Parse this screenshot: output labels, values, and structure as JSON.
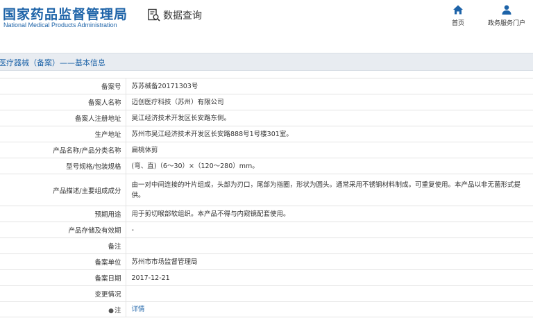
{
  "header": {
    "logo_cn": "国家药品监督管理局",
    "logo_en": "National Medical Products Administration",
    "query_label": "数据查询",
    "nav": [
      {
        "label": "首页",
        "icon": "home-icon"
      },
      {
        "label": "政务服务门户",
        "icon": "user-icon"
      }
    ]
  },
  "section": {
    "title": "医疗器械（备案）——基本信息"
  },
  "table": {
    "rows": [
      {
        "label": "备案号",
        "value": "苏苏械备20171303号"
      },
      {
        "label": "备案人名称",
        "value": "迈创医疗科技（苏州）有限公司"
      },
      {
        "label": "备案人注册地址",
        "value": "吴江经济技术开发区长安路东侧。"
      },
      {
        "label": "生产地址",
        "value": "苏州市吴江经济技术开发区长安路888号1号楼301室。"
      },
      {
        "label": "产品名称/产品分类名称",
        "value": "扁桃体剪"
      },
      {
        "label": "型号规格/包装规格",
        "value": "(弯、直)（6～30）×（120～280）mm。"
      },
      {
        "label": "产品描述/主要组成成分",
        "value": "由一对中间连接的叶片组成，头部为刃口，尾部为指圈，形状为圆头。通常采用不锈钢材料制成。可重复使用。本产品以非无菌形式提供。"
      },
      {
        "label": "预期用途",
        "value": "用于剪切喉部软组织。本产品不得与内窥镜配套使用。"
      },
      {
        "label": "产品存储及有效期",
        "value": "-"
      },
      {
        "label": "备注",
        "value": ""
      },
      {
        "label": "备案单位",
        "value": "苏州市市场监督管理局"
      },
      {
        "label": "备案日期",
        "value": "2017-12-21"
      },
      {
        "label": "变更情况",
        "value": ""
      },
      {
        "label": "注",
        "value": "详情",
        "icon": "pin-icon"
      }
    ]
  }
}
